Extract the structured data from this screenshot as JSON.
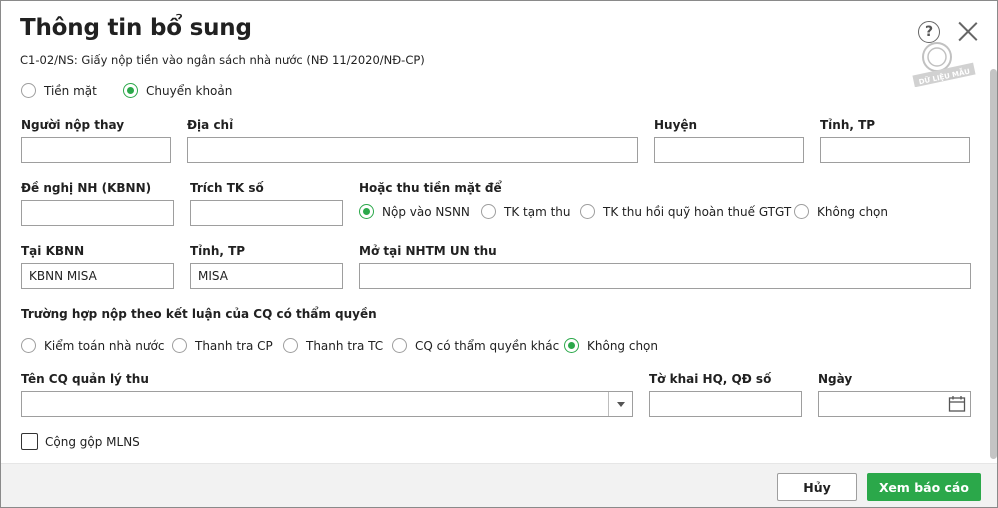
{
  "dialog": {
    "title": "Thông tin bổ sung",
    "subtitle": "C1-02/NS: Giấy nộp tiền vào ngân sách nhà nước (NĐ 11/2020/NĐ-CP)",
    "help_glyph": "?",
    "stamp_text": "DỮ LIỆU MẪU"
  },
  "payment_method": {
    "options": [
      "Tiền mặt",
      "Chuyển khoản"
    ],
    "selected": "Chuyển khoản"
  },
  "row1": {
    "payer_label": "Người nộp thay",
    "payer_value": "",
    "address_label": "Địa chỉ",
    "address_value": "",
    "district_label": "Huyện",
    "district_value": "",
    "province_label": "Tỉnh, TP",
    "province_value": ""
  },
  "row2": {
    "bank_request_label": "Đề nghị NH (KBNN)",
    "bank_request_value": "",
    "account_label": "Trích TK số",
    "account_value": "",
    "cash_label": "Hoặc thu tiền mặt để",
    "cash_options": [
      "Nộp vào NSNN",
      "TK tạm thu",
      "TK thu hồi quỹ hoàn thuế GTGT",
      "Không chọn"
    ],
    "cash_selected": "Nộp vào NSNN"
  },
  "row3": {
    "kbnn_label": "Tại KBNN",
    "kbnn_value": "KBNN MISA",
    "province_label": "Tỉnh, TP",
    "province_value": "MISA",
    "bank_label": "Mở tại NHTM UN thu",
    "bank_value": ""
  },
  "conclusion": {
    "label": "Trường hợp nộp theo kết luận của CQ có thẩm quyền",
    "options": [
      "Kiểm toán nhà nước",
      "Thanh tra CP",
      "Thanh tra TC",
      "CQ có thẩm quyền khác",
      "Không chọn"
    ],
    "selected": "Không chọn"
  },
  "row4": {
    "agency_label": "Tên CQ quản lý thu",
    "agency_value": "",
    "declaration_label": "Tờ khai HQ, QĐ số",
    "declaration_value": "",
    "date_label": "Ngày",
    "date_value": ""
  },
  "merge": {
    "label": "Cộng gộp MLNS",
    "checked": false
  },
  "footer": {
    "cancel_label": "Hủy",
    "submit_label": "Xem báo cáo"
  },
  "colors": {
    "accent": "#2ba84a",
    "border": "#9e9e9e",
    "footer_bg": "#f2f2f2"
  }
}
